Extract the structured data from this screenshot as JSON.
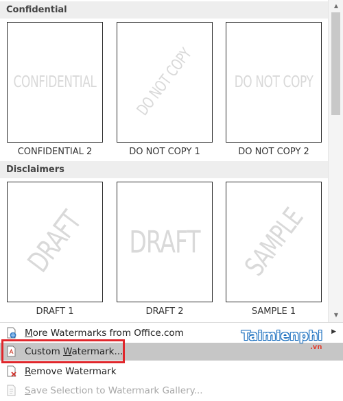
{
  "gallery": {
    "sections": [
      {
        "title": "Confidential",
        "items": [
          {
            "caption": "CONFIDENTIAL 2",
            "watermark": "CONFIDENTIAL"
          },
          {
            "caption": "DO NOT COPY 1",
            "watermark": "DO NOT COPY"
          },
          {
            "caption": "DO NOT COPY 2",
            "watermark": "DO NOT COPY"
          }
        ]
      },
      {
        "title": "Disclaimers",
        "items": [
          {
            "caption": "DRAFT 1",
            "watermark": "DRAFT"
          },
          {
            "caption": "DRAFT 2",
            "watermark": "DRAFT"
          },
          {
            "caption": "SAMPLE 1",
            "watermark": "SAMPLE"
          }
        ]
      }
    ]
  },
  "menu": {
    "more": {
      "label": "More Watermarks from Office.com",
      "mnemonic": "M"
    },
    "custom": {
      "label": "Custom Watermark...",
      "mnemonic": "W"
    },
    "remove": {
      "label": "Remove Watermark",
      "mnemonic": "R"
    },
    "save": {
      "label": "Save Selection to Watermark Gallery...",
      "mnemonic": "S"
    }
  },
  "logo": {
    "brand": "Taimienphi",
    "tld": ".vn"
  },
  "colors": {
    "highlight_border": "#e0262b",
    "hover_bg": "#c6c6c6",
    "watermark_text": "#d9d9d9"
  }
}
